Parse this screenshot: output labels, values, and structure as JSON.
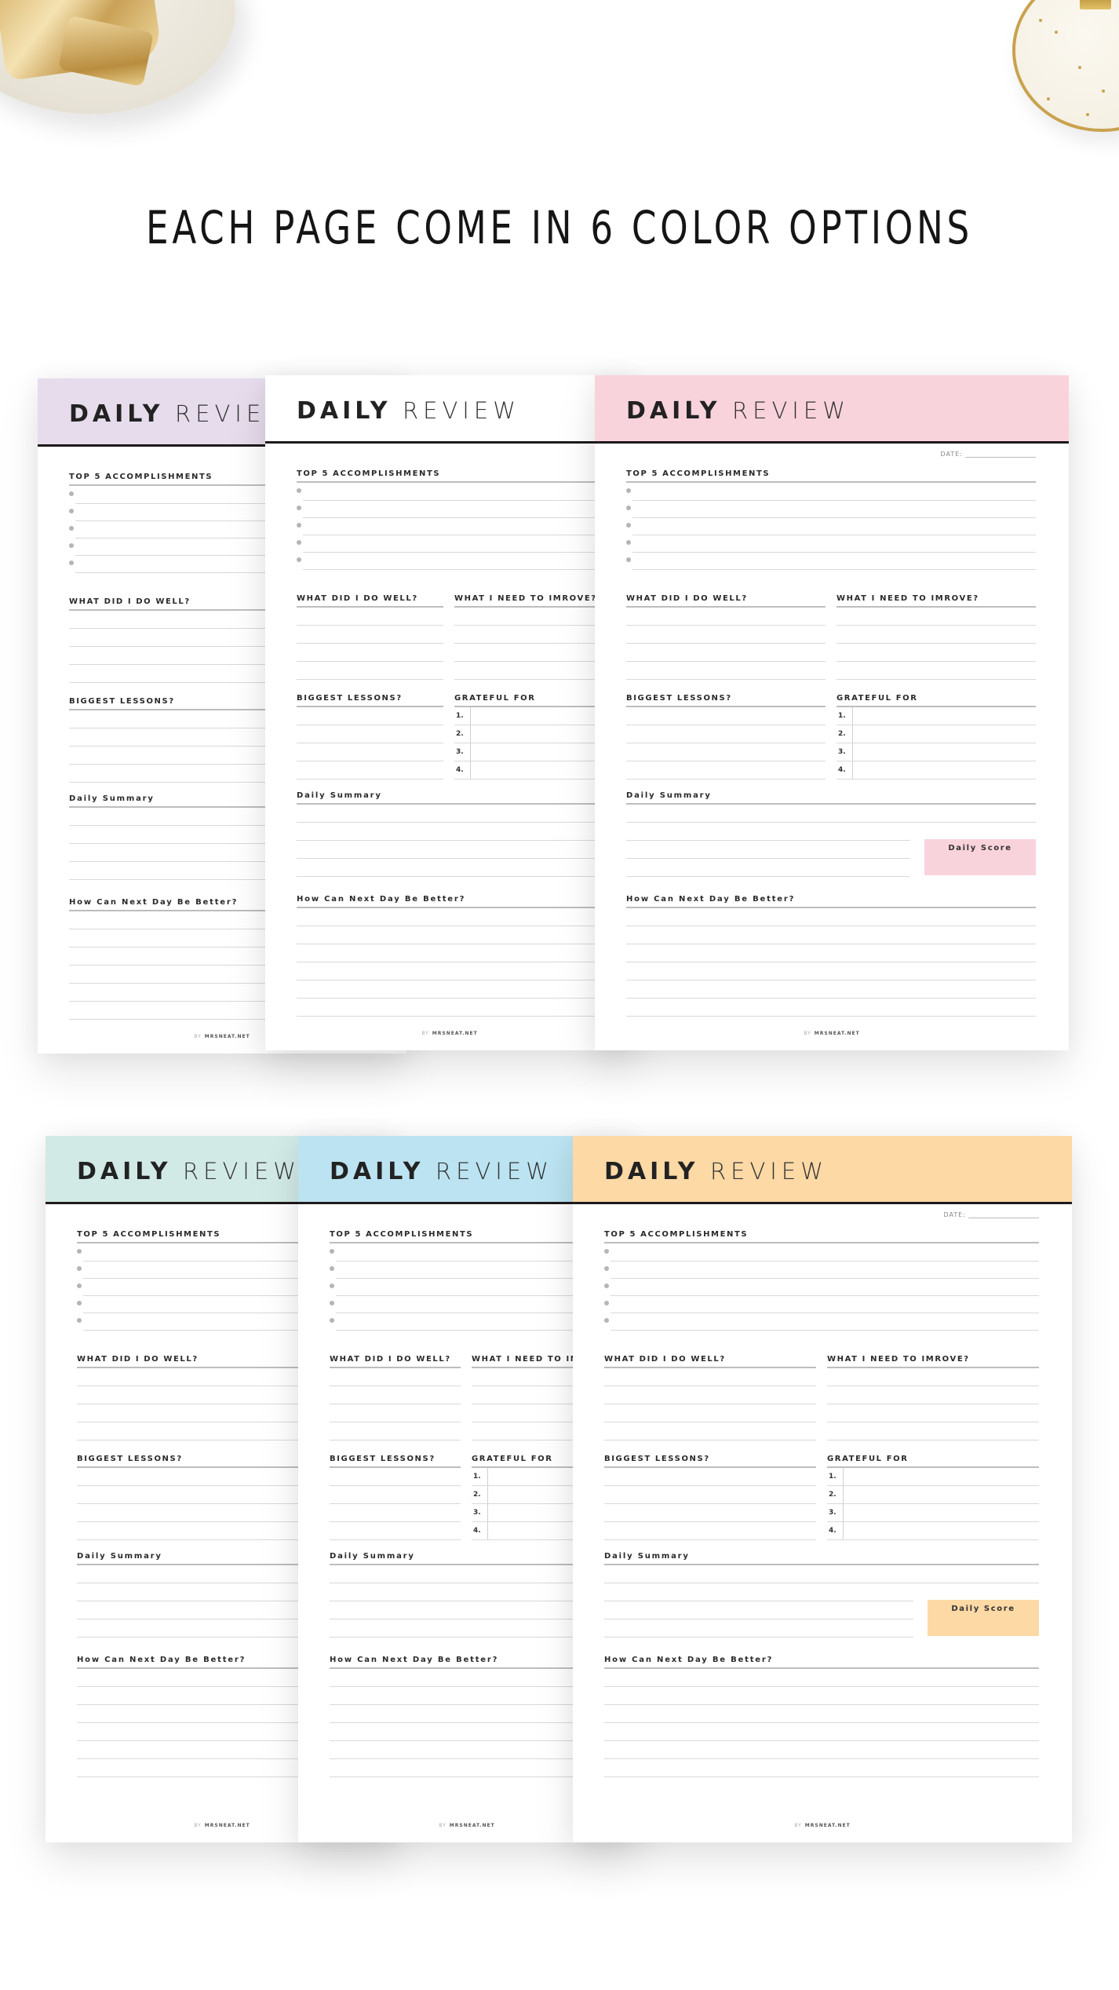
{
  "headline": "EACH PAGE COME IN 6 COLOR OPTIONS",
  "decor": {
    "top_left": "gold-binder-clips-bowl",
    "top_right": "gold-rim-plate-with-clip"
  },
  "planner": {
    "title_bold": "DAILY",
    "title_light": "REVIEW",
    "date_label": "DATE:",
    "sections": {
      "accomplishments": "TOP 5 ACCOMPLISHMENTS",
      "did_well": "WHAT DID I DO WELL?",
      "improve": "WHAT I NEED TO IMROVE?",
      "lessons": "BIGGEST LESSONS?",
      "grateful": "GRATEFUL FOR",
      "summary": "Daily Summary",
      "score": "Daily Score",
      "next_day": "How Can Next Day Be Better?"
    },
    "grateful_numbers": [
      "1.",
      "2.",
      "3.",
      "4."
    ],
    "footer_by": "BY",
    "footer_brand": "MRSNEAT.NET"
  },
  "color_options": [
    {
      "name": "lavender",
      "hex": "#e6dcec"
    },
    {
      "name": "white",
      "hex": "#ffffff"
    },
    {
      "name": "pink",
      "hex": "#f9d3dc"
    },
    {
      "name": "mint",
      "hex": "#d2eae6"
    },
    {
      "name": "sky-blue",
      "hex": "#bce3f1"
    },
    {
      "name": "peach",
      "hex": "#fcd9a5"
    }
  ]
}
